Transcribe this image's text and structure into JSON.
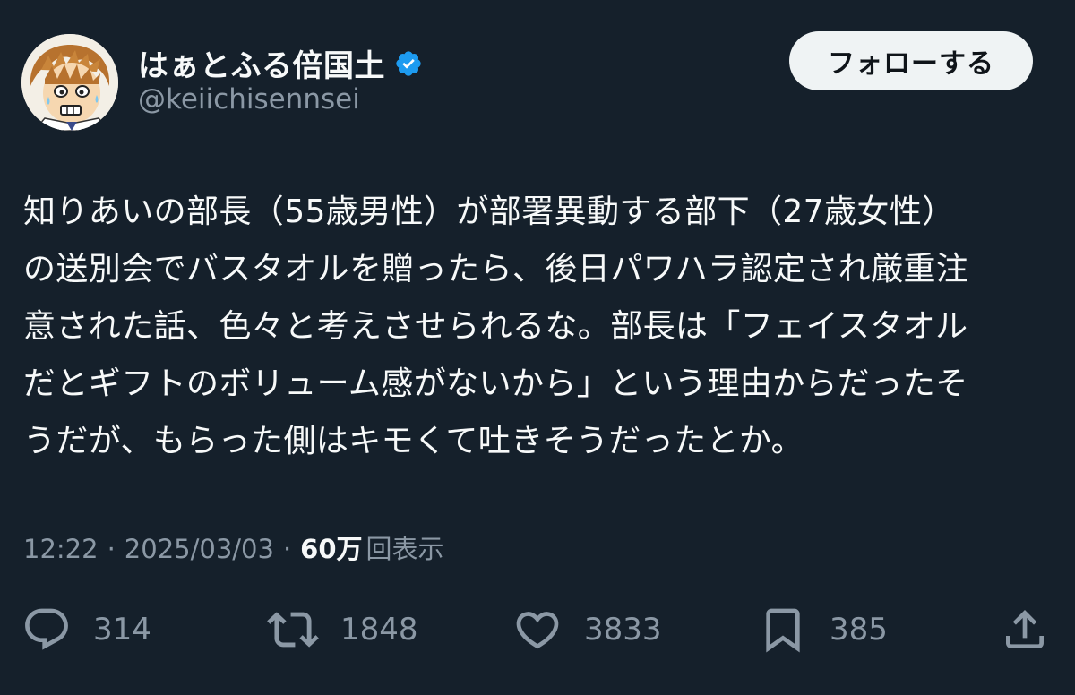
{
  "author": {
    "display_name": "はぁとふる倍国土",
    "handle": "@keiichisennsei",
    "verified": true
  },
  "follow_label": "フォローする",
  "tweet": {
    "lines": [
      "知りあいの部長（55歳男性）が部署異動する部下（27歳女性）",
      "の送別会でバスタオルを贈ったら、後日パワハラ認定され厳重注",
      "意された話、色々と考えさせられるな。部長は「フェイスタオル",
      "だとギフトのボリューム感がないから」という理由からだったそ",
      "うだが、もらった側はキモくて吐きそうだったとか。"
    ]
  },
  "meta": {
    "time": "12:22",
    "separator": "·",
    "date": "2025/03/03",
    "views_count": "60万",
    "views_label": "回表示"
  },
  "actions": {
    "reply_count": "314",
    "retweet_count": "1848",
    "like_count": "3833",
    "bookmark_count": "385"
  },
  "colors": {
    "background": "#15202b",
    "text_primary": "#f7f9f9",
    "text_secondary": "#8b98a5",
    "verified": "#1d9bf0",
    "follow_button_bg": "#eff3f4"
  },
  "icons": {
    "verified": "verified-badge-icon",
    "reply": "speech-bubble-icon",
    "retweet": "retweet-arrows-icon",
    "like": "heart-icon",
    "bookmark": "bookmark-icon",
    "share": "share-upload-icon"
  }
}
